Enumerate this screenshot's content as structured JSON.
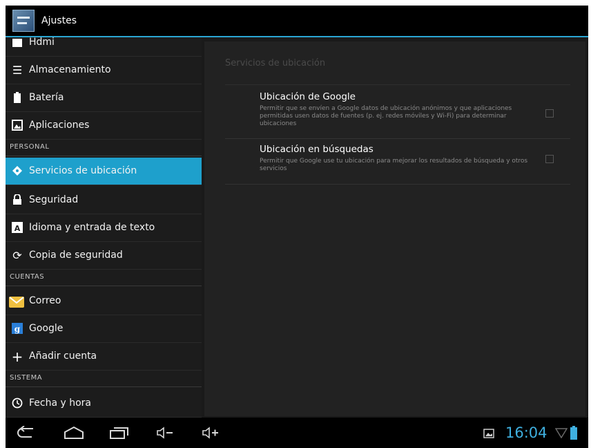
{
  "app": {
    "title": "Ajustes",
    "accent": "#1ea0cc"
  },
  "sidebar": {
    "items": [
      {
        "label": "Hdmi",
        "icon": "hdmi-icon"
      },
      {
        "label": "Almacenamiento",
        "icon": "storage-icon"
      },
      {
        "label": "Batería",
        "icon": "battery-icon"
      },
      {
        "label": "Aplicaciones",
        "icon": "apps-icon"
      },
      {
        "label": "Servicios de ubicación",
        "icon": "location-icon",
        "selected": true
      },
      {
        "label": "Seguridad",
        "icon": "lock-icon"
      },
      {
        "label": "Idioma y entrada de texto",
        "icon": "language-icon"
      },
      {
        "label": "Copia de seguridad",
        "icon": "backup-icon"
      },
      {
        "label": "Correo",
        "icon": "mail-icon"
      },
      {
        "label": "Google",
        "icon": "google-icon"
      },
      {
        "label": "Añadir cuenta",
        "icon": "add-icon"
      },
      {
        "label": "Fecha y hora",
        "icon": "clock-icon"
      }
    ],
    "headers": {
      "personal": "PERSONAL",
      "cuentas": "CUENTAS",
      "sistema": "SISTEMA"
    }
  },
  "main": {
    "section_title": "Servicios de ubicación",
    "settings": [
      {
        "title": "Ubicación de Google",
        "summary": "Permitir que se envíen a Google datos de ubicación anónimos y que aplicaciones permitidas usen datos de fuentes (p. ej. redes móviles y Wi-Fi) para determinar ubicaciones",
        "checked": false
      },
      {
        "title": "Ubicación en búsquedas",
        "summary": "Permitir que Google use tu ubicación para mejorar los resultados de búsqueda y otros servicios",
        "checked": false
      }
    ]
  },
  "navbar": {
    "buttons": [
      "back-icon",
      "home-icon",
      "recent-apps-icon",
      "volume-down-icon",
      "volume-up-icon"
    ],
    "status": {
      "time": "16:04",
      "icons": [
        "screenshot-icon",
        "wifi-icon",
        "battery-status-icon"
      ]
    }
  }
}
